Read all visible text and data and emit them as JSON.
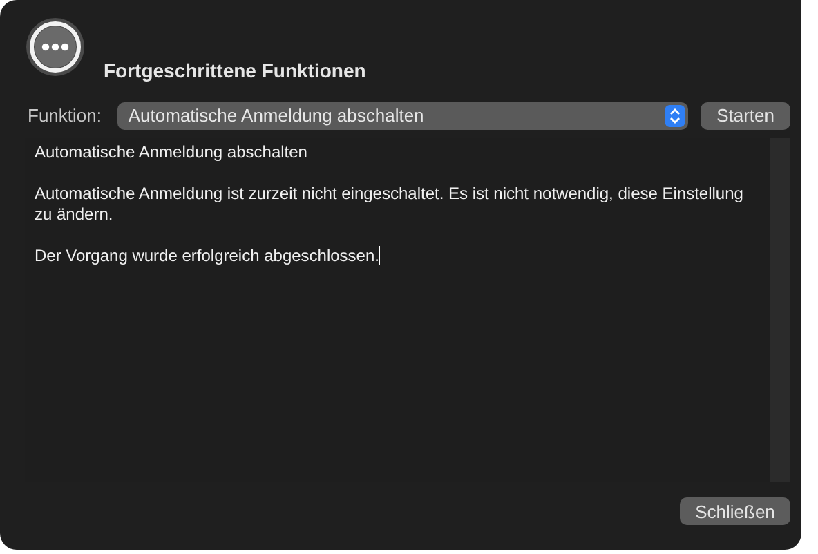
{
  "window": {
    "title": "Fortgeschrittene Funktionen"
  },
  "function_row": {
    "label": "Funktion:",
    "popup": {
      "value": "Automatische Anmeldung abschalten"
    },
    "start_button": "Starten"
  },
  "output": {
    "paragraphs": [
      "Automatische Anmeldung abschalten",
      "Automatische Anmeldung ist zurzeit nicht eingeschaltet. Es ist nicht notwendig, diese Einstellung zu ändern.",
      "Der Vorgang wurde erfolgreich abgeschlossen."
    ],
    "cursor": true
  },
  "buttons": [
    "Schließen"
  ]
}
